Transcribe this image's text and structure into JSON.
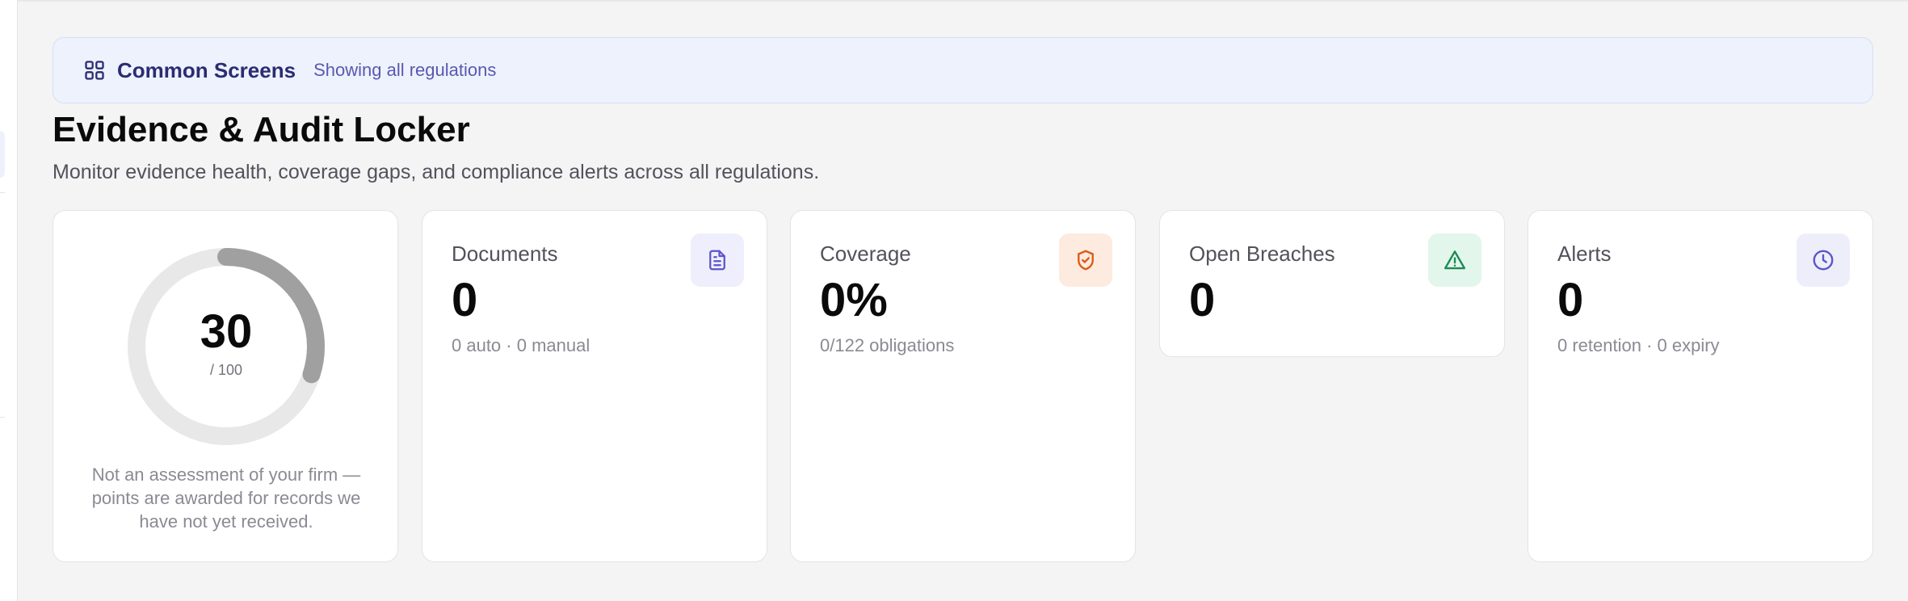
{
  "banner": {
    "icon": "grid-icon",
    "title": "Common Screens",
    "subtitle": "Showing all regulations"
  },
  "page": {
    "title": "Evidence & Audit Locker",
    "subtitle": "Monitor evidence health, coverage gaps, and compliance alerts across all regulations."
  },
  "score": {
    "value": "30",
    "max": "/ 100",
    "fraction": 0.3,
    "note": "Not an assessment of your firm — points are awarded for records we have not yet received."
  },
  "cards": [
    {
      "label": "Documents",
      "value": "0",
      "meta": "0 auto · 0 manual",
      "icon": "document-icon",
      "icon_bg": "#efeefc",
      "icon_color": "#5b55c9"
    },
    {
      "label": "Coverage",
      "value": "0%",
      "meta": "0/122 obligations",
      "icon": "shield-check-icon",
      "icon_bg": "#fdebe0",
      "icon_color": "#e05a14"
    },
    {
      "label": "Open Breaches",
      "value": "0",
      "meta": "",
      "icon": "warning-triangle-icon",
      "icon_bg": "#e3f6ec",
      "icon_color": "#1f8a55"
    },
    {
      "label": "Alerts",
      "value": "0",
      "meta": "0 retention · 0 expiry",
      "icon": "clock-icon",
      "icon_bg": "#eeeefb",
      "icon_color": "#5b55c9"
    }
  ],
  "colors": {
    "donut_track": "#e8e8e8",
    "donut_fill": "#a0a0a0"
  }
}
